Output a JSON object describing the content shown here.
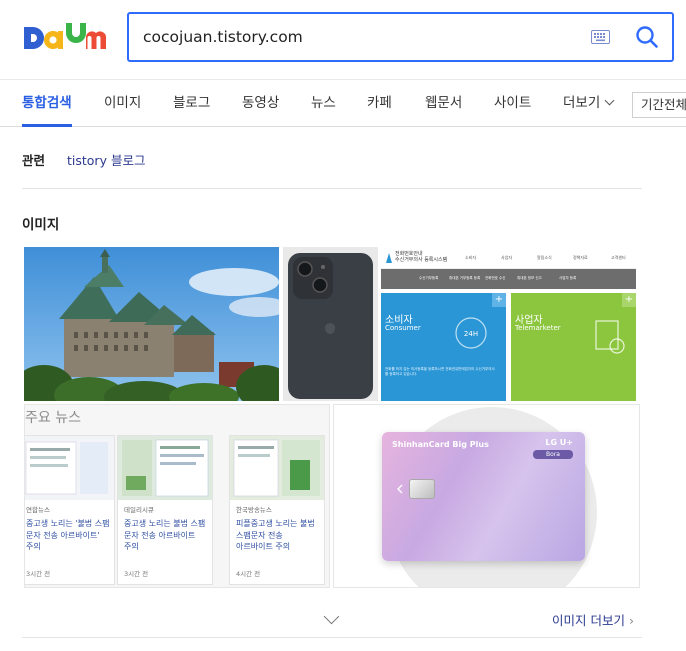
{
  "brand": {
    "name": "Daum"
  },
  "search": {
    "query": "cocojuan.tistory.com"
  },
  "tabs": [
    {
      "label": "통합검색"
    },
    {
      "label": "이미지"
    },
    {
      "label": "블로그"
    },
    {
      "label": "동영상"
    },
    {
      "label": "뉴스"
    },
    {
      "label": "카페"
    },
    {
      "label": "웹문서"
    },
    {
      "label": "사이트"
    }
  ],
  "tabs_more": {
    "label": "더보기"
  },
  "period_filter": {
    "value": "기간전체"
  },
  "related": {
    "label": "관련",
    "link": "tistory 블로그"
  },
  "image_section": {
    "title": "이미지",
    "more_label": "이미지 더보기",
    "more_arrow": "›"
  },
  "img3": {
    "site_title": "전화번호안내\n수신거부의사 등록시스템",
    "nav": [
      "소비자",
      "사업자",
      "알림소식",
      "정책자료",
      "고객센터"
    ],
    "subnav": [
      "수신거부등록",
      "휴대폰 거부등록 등록",
      "전화번호 수신",
      "휴대폰 정보 신고",
      "사업자 등록"
    ],
    "consumer_title": "소비자",
    "consumer_sub": "Consumer",
    "consumer_text": "전화를 하지 않는 의사등록을 등록하시면 전화권유판매업자의 수신거부의사를 등록하고 있습니다.",
    "marketer_title": "사업자",
    "marketer_sub": "Telemarketer"
  },
  "img4": {
    "heading": "주요 뉴스",
    "cards": [
      {
        "source": "연합뉴스",
        "headline": "중고생 노리는 '불법 스팸 문자 전송 아르바이트' 주의",
        "time": "3시간 전"
      },
      {
        "source": "데일리시큐",
        "headline": "중고생 노리는 불법 스팸 문자 전송 아르바이트 주의",
        "time": "3시간 전"
      },
      {
        "source": "한국방송뉴스",
        "headline": "피플중고생 노리는 불법 스팸문자 전송 아르바이트 주의",
        "time": "4시간 전"
      }
    ]
  },
  "img5": {
    "card_brand": "ShinhanCard Big Plus",
    "card_partner": "LG U+",
    "card_name": "Bora"
  }
}
